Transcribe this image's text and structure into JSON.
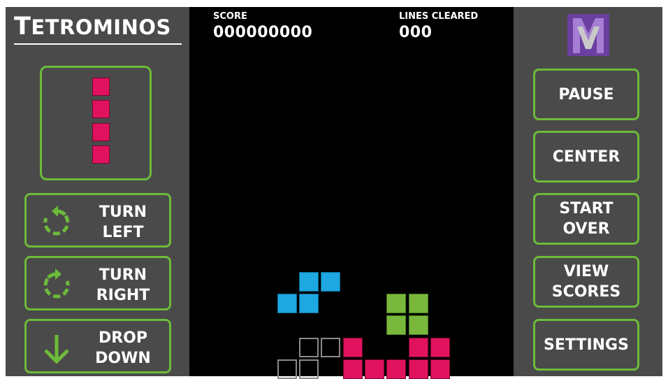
{
  "app": {
    "title_first": "T",
    "title_rest": "ETROMINOS"
  },
  "hud": {
    "score_label": "SCORE",
    "score_value": "000000000",
    "lines_label": "LINES CLEARED",
    "lines_value": "000"
  },
  "controls": {
    "turn_left": [
      "TURN",
      "LEFT"
    ],
    "turn_right": [
      "TURN",
      "RIGHT"
    ],
    "drop_down": [
      "DROP",
      "DOWN"
    ]
  },
  "actions": {
    "pause": "PAUSE",
    "center": "CENTER",
    "start_over": [
      "START",
      "OVER"
    ],
    "view_scores": [
      "VIEW",
      "SCORES"
    ],
    "settings": "SETTINGS"
  },
  "colors": {
    "panel": "#4a4a4a",
    "board": "#000000",
    "button_border": "#6dbb3a",
    "piece_pink": "#e0125e",
    "piece_cyan": "#1ea7e1",
    "piece_green": "#79b83c",
    "ghost_outline": "#8a8a8a"
  },
  "icons": {
    "turn_left": "rotate-left-icon",
    "turn_right": "rotate-right-icon",
    "drop_down": "arrow-down-icon",
    "logo": "brand-logo-icon"
  },
  "next_piece": {
    "shape": "I",
    "color": "pink"
  },
  "board": {
    "columns": 15,
    "pieces": [
      {
        "type": "S",
        "color": "cyan",
        "cells": [
          [
            5,
            12
          ],
          [
            6,
            12
          ],
          [
            4,
            13
          ],
          [
            5,
            13
          ]
        ]
      },
      {
        "type": "O",
        "color": "green",
        "cells": [
          [
            9,
            13
          ],
          [
            10,
            13
          ],
          [
            9,
            14
          ],
          [
            10,
            14
          ]
        ]
      },
      {
        "type": "ghost",
        "color": "ghost",
        "cells": [
          [
            5,
            15
          ],
          [
            6,
            15
          ],
          [
            4,
            16
          ],
          [
            5,
            16
          ]
        ]
      },
      {
        "type": "stack",
        "color": "pink",
        "cells": [
          [
            7,
            15
          ],
          [
            10,
            15
          ],
          [
            11,
            15
          ],
          [
            7,
            16
          ],
          [
            8,
            16
          ],
          [
            9,
            16
          ],
          [
            10,
            16
          ],
          [
            11,
            16
          ]
        ]
      }
    ]
  }
}
